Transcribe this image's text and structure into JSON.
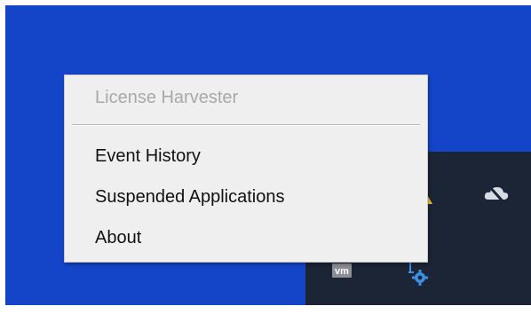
{
  "context_menu": {
    "header": "License Harvester",
    "items": [
      {
        "label": "Event History"
      },
      {
        "label": "Suspended Applications"
      },
      {
        "label": "About"
      }
    ]
  },
  "tray": {
    "icons": [
      {
        "name": "warning-shield-icon"
      },
      {
        "name": "cloud-off-icon"
      },
      {
        "name": "vmware-icon",
        "text": "vm"
      },
      {
        "name": "license-gear-icon"
      }
    ]
  },
  "colors": {
    "desktop_background": "#1445c9",
    "tray_background": "#1b2536",
    "menu_background": "#efefef",
    "menu_header_text": "#a8a8a8",
    "menu_item_text": "#111111"
  }
}
